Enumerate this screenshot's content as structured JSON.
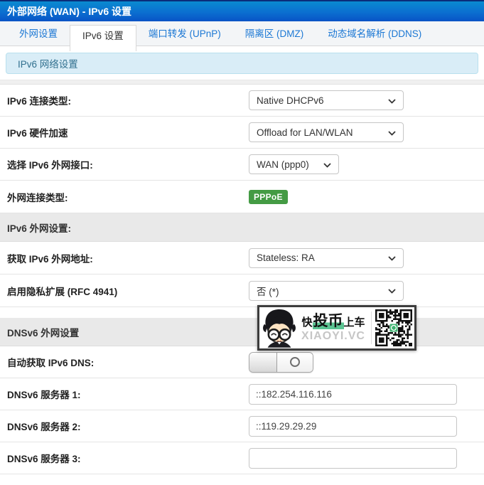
{
  "header": {
    "title": "外部网络 (WAN) - IPv6 设置"
  },
  "tabs": {
    "items": [
      {
        "label": "外网设置"
      },
      {
        "label": "IPv6 设置"
      },
      {
        "label": "端口转发 (UPnP)"
      },
      {
        "label": "隔离区 (DMZ)"
      },
      {
        "label": "动态域名解析 (DDNS)"
      }
    ]
  },
  "banner": {
    "text": "IPv6 网络设置"
  },
  "form": {
    "connection_type": {
      "label": "IPv6 连接类型:",
      "value": "Native DHCPv6"
    },
    "hw_accel": {
      "label": "IPv6 硬件加速",
      "value": "Offload for LAN/WLAN"
    },
    "wan_interface": {
      "label": "选择 IPv6 外网接口:",
      "value": "WAN (ppp0)"
    },
    "wan_conn_type": {
      "label": "外网连接类型:",
      "badge": "PPPoE"
    },
    "section_wan": {
      "title": "IPv6 外网设置:"
    },
    "addr_mode": {
      "label": "获取 IPv6 外网地址:",
      "value": "Stateless: RA"
    },
    "privacy_ext": {
      "label": "启用隐私扩展 (RFC 4941)",
      "value": "否 (*)"
    },
    "section_dns": {
      "title": "DNSv6 外网设置"
    },
    "auto_dns": {
      "label": "自动获取 IPv6 DNS:",
      "state": "off"
    },
    "dns1": {
      "label": "DNSv6 服务器 1:",
      "value": "::182.254.116.116"
    },
    "dns2": {
      "label": "DNSv6 服务器 2:",
      "value": "::119.29.29.29"
    },
    "dns3": {
      "label": "DNSv6 服务器 3:",
      "value": ""
    }
  },
  "watermark": {
    "prefix": "快",
    "highlight": "投币",
    "suffix": "上车",
    "site": "XIAOYI.VC"
  },
  "colors": {
    "accent_blue": "#1c78d4",
    "badge_green": "#449b44",
    "highlight_green": "#5bc492",
    "banner_bg": "#d9edf7",
    "banner_text": "#31708f"
  }
}
